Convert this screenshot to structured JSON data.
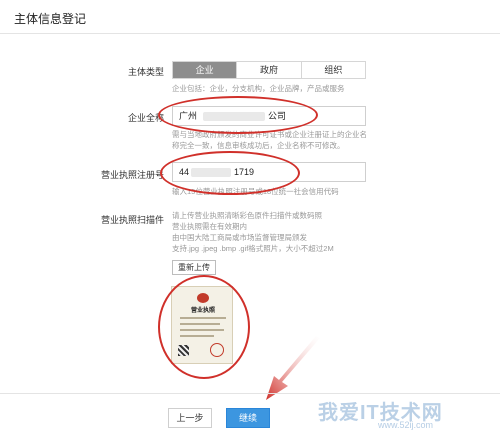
{
  "header": {
    "title": "主体信息登记"
  },
  "entity_type": {
    "label": "主体类型",
    "tabs": [
      {
        "label": "企业",
        "active": true
      },
      {
        "label": "政府",
        "active": false
      },
      {
        "label": "组织",
        "active": false
      }
    ],
    "hint": "企业包括：企业，分支机构，企业品牌，产品或服务"
  },
  "company_name": {
    "label": "企业全称",
    "value_start": "广州",
    "value_end": "公司",
    "hint_line1": "需与当地政府颁发的商业许可证书或企业注册证上的企业名",
    "hint_line2": "称完全一致，信息审核成功后，企业名称不可修改。"
  },
  "license_number": {
    "label": "营业执照注册号",
    "value_start": "44",
    "value_end": "1719",
    "hint": "输入15位营业执照注册号或18位统一社会信用代码"
  },
  "license_scan": {
    "label": "营业执照扫描件",
    "hint_lines": [
      "请上传营业执照清晰彩色原件扫描件或数码照",
      "营业执照需在有效期内",
      "由中国大陆工商局或市场监督管理局颁发",
      "支持.jpg .jpeg .bmp .gif格式照片，大小不超过2M"
    ],
    "reupload_label": "重新上传",
    "preview_title": "营业执照"
  },
  "footer": {
    "prev_label": "上一步",
    "next_label": "继续"
  },
  "watermark": {
    "main": "我爱IT技术网",
    "sub": "www.52ij.com"
  },
  "colors": {
    "accent": "#3c96e0",
    "annotation": "#d0302a",
    "tab_active": "#8e8e8e"
  }
}
